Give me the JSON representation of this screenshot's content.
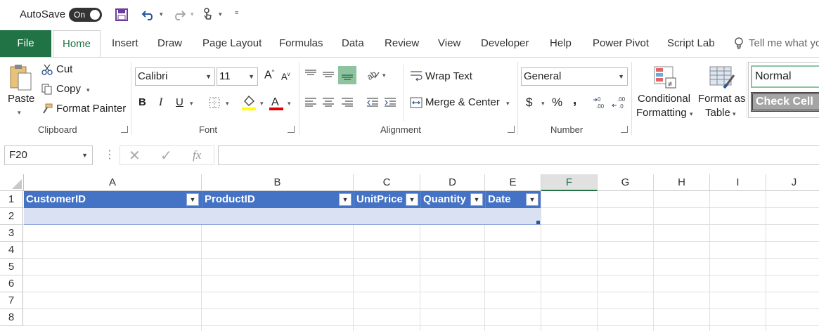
{
  "qat": {
    "autosave_label": "AutoSave",
    "autosave_state": "On"
  },
  "tabs": [
    "File",
    "Home",
    "Insert",
    "Draw",
    "Page Layout",
    "Formulas",
    "Data",
    "Review",
    "View",
    "Developer",
    "Help",
    "Power Pivot",
    "Script Lab"
  ],
  "tell_me": "Tell me what you",
  "clipboard": {
    "paste": "Paste",
    "cut": "Cut",
    "copy": "Copy",
    "format_painter": "Format Painter",
    "group_label": "Clipboard"
  },
  "font": {
    "family": "Calibri",
    "size": "11",
    "group_label": "Font",
    "bold": "B",
    "italic": "I",
    "underline": "U",
    "highlight_color": "#ffff00",
    "font_color": "#e00000"
  },
  "alignment": {
    "wrap_text": "Wrap Text",
    "merge_center": "Merge & Center",
    "group_label": "Alignment"
  },
  "number": {
    "format": "General",
    "currency": "$",
    "percent": "%",
    "comma": ",",
    "group_label": "Number"
  },
  "styles": {
    "conditional_1": "Conditional",
    "conditional_2": "Formatting",
    "format_as_1": "Format as",
    "format_as_2": "Table",
    "normal": "Normal",
    "check_cell": "Check Cell"
  },
  "formula_bar": {
    "name_box": "F20",
    "fx": "fx",
    "value": ""
  },
  "grid": {
    "columns": [
      "A",
      "B",
      "C",
      "D",
      "E",
      "F",
      "G",
      "H",
      "I",
      "J"
    ],
    "selected_column": "F",
    "rows": [
      "1",
      "2",
      "3",
      "4",
      "5",
      "6",
      "7",
      "8"
    ],
    "table_headers": [
      "CustomerID",
      "ProductID",
      "UnitPrice",
      "Quantity",
      "Date"
    ]
  },
  "colors": {
    "excel_green": "#217346",
    "table_header": "#4472c4",
    "table_band": "#d9e1f2"
  }
}
